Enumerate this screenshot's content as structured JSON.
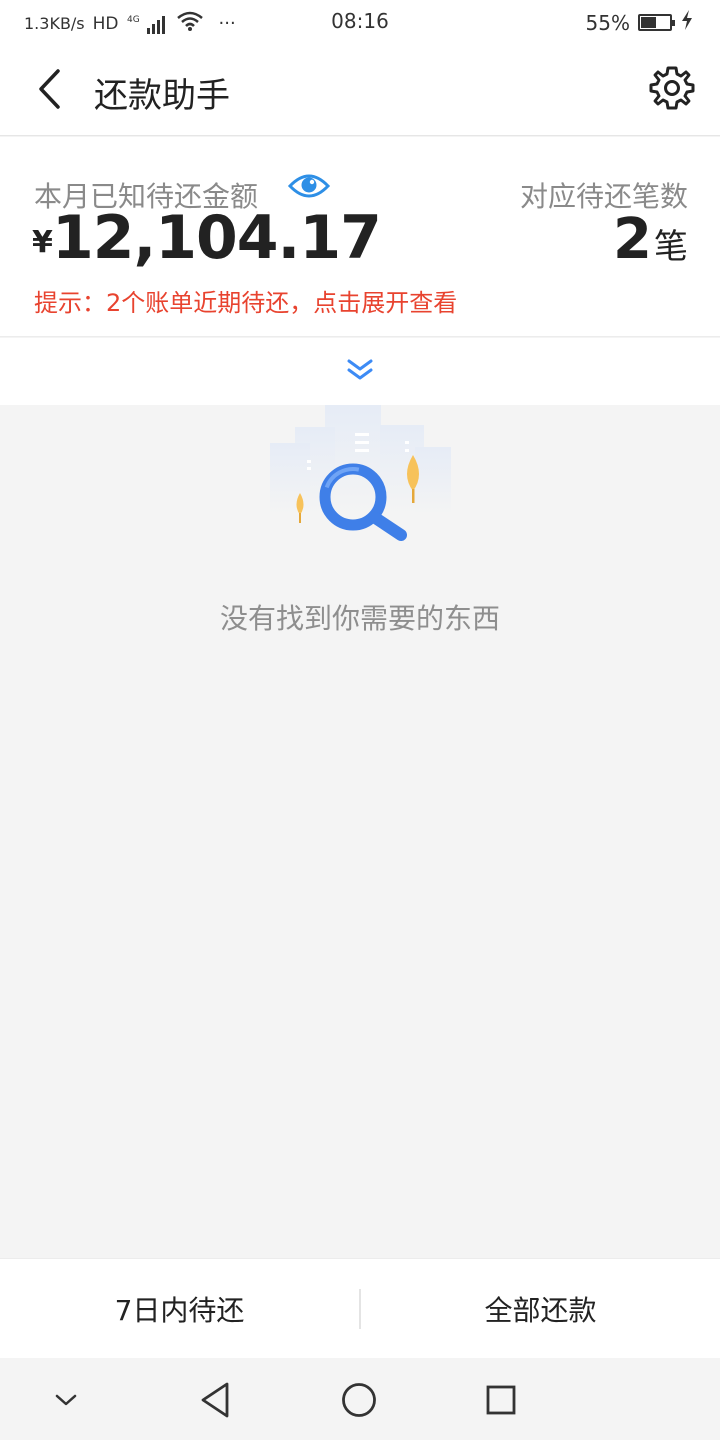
{
  "status_bar": {
    "net_speed": "1.3KB/s",
    "hd": "HD",
    "network": "4G",
    "more": "···",
    "time": "08:16",
    "battery_percent_text": "55%",
    "battery_level": 0.55
  },
  "header": {
    "title": "还款助手"
  },
  "summary": {
    "label": "本月已知待还金额",
    "currency": "¥",
    "amount": "12,104.17",
    "count_label": "对应待还笔数",
    "count": "2",
    "count_unit": "笔",
    "tip": "提示：2个账单近期待还，点击展开查看"
  },
  "empty_state": {
    "text": "没有找到你需要的东西"
  },
  "bottom_actions": {
    "left": "7日内待还",
    "right": "全部还款"
  },
  "colors": {
    "accent_blue": "#3d8bf5",
    "tip_red": "#e8432f",
    "illus_yellow": "#f7c25a"
  }
}
